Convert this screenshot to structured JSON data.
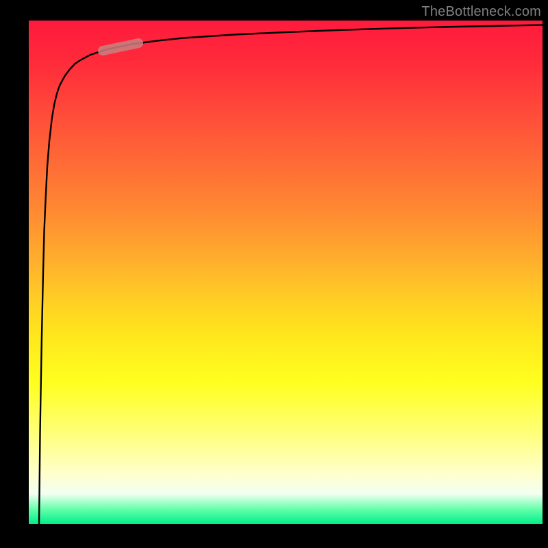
{
  "watermark": "TheBottleneck.com",
  "colors": {
    "frame": "#000000",
    "curve": "#000000",
    "highlight": "#c98080",
    "gradient_top": "#ff1a3d",
    "gradient_bottom": "#00ee88",
    "watermark_text": "#808080"
  },
  "chart_data": {
    "type": "line",
    "title": "",
    "xlabel": "",
    "ylabel": "",
    "xlim": [
      0,
      100
    ],
    "ylim": [
      0,
      100
    ],
    "grid": false,
    "legend": false,
    "series": [
      {
        "name": "curve",
        "x": [
          2.0,
          2.2,
          2.5,
          2.8,
          3.0,
          3.3,
          3.6,
          4.0,
          4.5,
          5.0,
          5.5,
          6.0,
          7.0,
          8.0,
          9.0,
          10.0,
          12.0,
          15.0,
          20.0,
          25.0,
          30.0,
          40.0,
          50.0,
          60.0,
          70.0,
          80.0,
          90.0,
          100.0
        ],
        "y": [
          0.0,
          18.0,
          36.0,
          50.0,
          58.0,
          65.0,
          71.0,
          76.0,
          80.5,
          83.5,
          85.5,
          87.0,
          89.0,
          90.4,
          91.4,
          92.1,
          93.2,
          94.2,
          95.3,
          96.0,
          96.5,
          97.2,
          97.7,
          98.1,
          98.4,
          98.7,
          98.9,
          99.1
        ]
      }
    ],
    "highlight_segment": {
      "x_range": [
        15.0,
        22.0
      ],
      "y_range": [
        93.9,
        95.4
      ]
    }
  }
}
